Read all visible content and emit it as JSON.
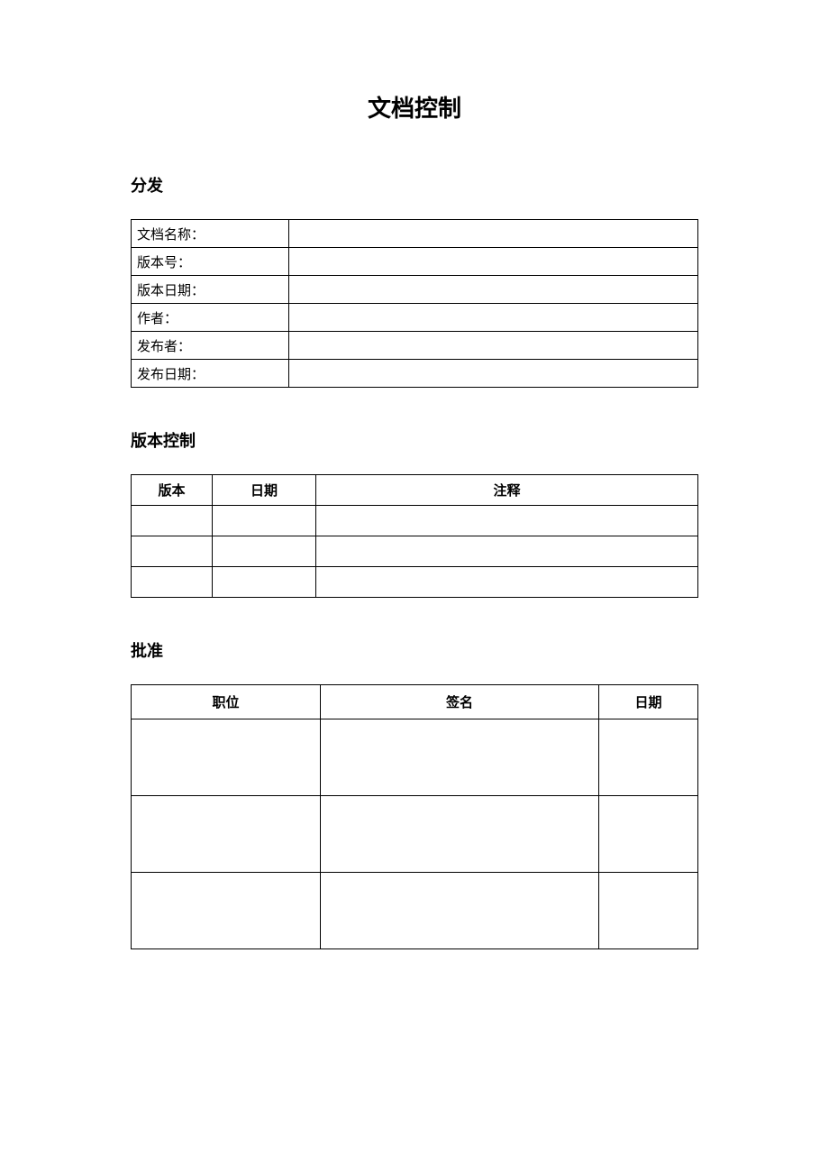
{
  "title": "文档控制",
  "distribution": {
    "heading": "分发",
    "rows": [
      {
        "label": "文档名称：",
        "value": ""
      },
      {
        "label": "版本号：",
        "value": ""
      },
      {
        "label": "版本日期：",
        "value": ""
      },
      {
        "label": "作者：",
        "value": ""
      },
      {
        "label": "发布者：",
        "value": ""
      },
      {
        "label": "发布日期：",
        "value": ""
      }
    ]
  },
  "version_control": {
    "heading": "版本控制",
    "headers": {
      "version": "版本",
      "date": "日期",
      "comment": "注释"
    },
    "rows": [
      {
        "version": "",
        "date": "",
        "comment": ""
      },
      {
        "version": "",
        "date": "",
        "comment": ""
      },
      {
        "version": "",
        "date": "",
        "comment": ""
      }
    ]
  },
  "approval": {
    "heading": "批准",
    "headers": {
      "position": "职位",
      "signature": "签名",
      "date": "日期"
    },
    "rows": [
      {
        "position": "",
        "signature": "",
        "date": ""
      },
      {
        "position": "",
        "signature": "",
        "date": ""
      },
      {
        "position": "",
        "signature": "",
        "date": ""
      }
    ]
  }
}
